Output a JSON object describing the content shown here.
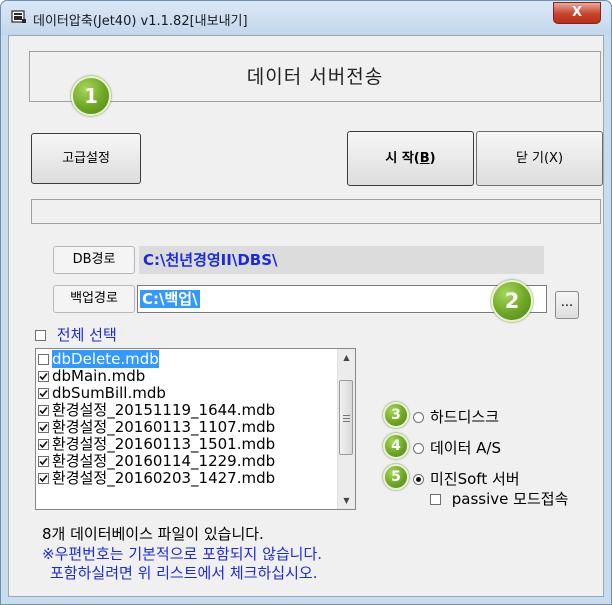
{
  "window": {
    "title": "데이터압축(Jet40) v1.1.82[내보내기]",
    "close_label": "X"
  },
  "header": {
    "title": "데이터 서버전송"
  },
  "toolbar": {
    "advanced_label": "고급설정",
    "start_label_prefix": "시 작(",
    "start_hotkey": "B",
    "start_label_suffix": ")",
    "close_label": "닫 기(X)"
  },
  "paths": {
    "db_label": "DB경로",
    "db_value": "C:\\천년경영II\\DBS\\",
    "backup_label": "백업경로",
    "backup_value": "C:\\백업\\",
    "browse_label": "..."
  },
  "select_all_label": "전체 선택",
  "files": [
    {
      "name": "dbDelete.mdb",
      "checked": false,
      "selected": true
    },
    {
      "name": "dbMain.mdb",
      "checked": true,
      "selected": false
    },
    {
      "name": "dbSumBill.mdb",
      "checked": true,
      "selected": false
    },
    {
      "name": "환경설정_20151119_1644.mdb",
      "checked": true,
      "selected": false
    },
    {
      "name": "환경설정_20160113_1107.mdb",
      "checked": true,
      "selected": false
    },
    {
      "name": "환경설정_20160113_1501.mdb",
      "checked": true,
      "selected": false
    },
    {
      "name": "환경설정_20160114_1229.mdb",
      "checked": true,
      "selected": false
    },
    {
      "name": "환경설정_20160203_1427.mdb",
      "checked": true,
      "selected": false
    }
  ],
  "destinations": [
    {
      "label": "하드디스크",
      "selected": false
    },
    {
      "label": "데이터 A/S",
      "selected": false
    },
    {
      "label": "미진Soft 서버",
      "selected": true
    }
  ],
  "passive_label": "passive 모드접속",
  "passive_checked": false,
  "badges": [
    "1",
    "2",
    "3",
    "4",
    "5"
  ],
  "status": {
    "line1": "8개 데이터베이스 파일이 있습니다.",
    "line2": "※우편번호는 기본적으로 포함되지 않습니다.",
    "line3": "포함하실려면 위 리스트에서 체크하십시오."
  },
  "colors": {
    "accent_blue": "#1c2bd8",
    "badge_green": "#6ea624",
    "selection": "#3399ff",
    "close_red": "#c7432c"
  }
}
